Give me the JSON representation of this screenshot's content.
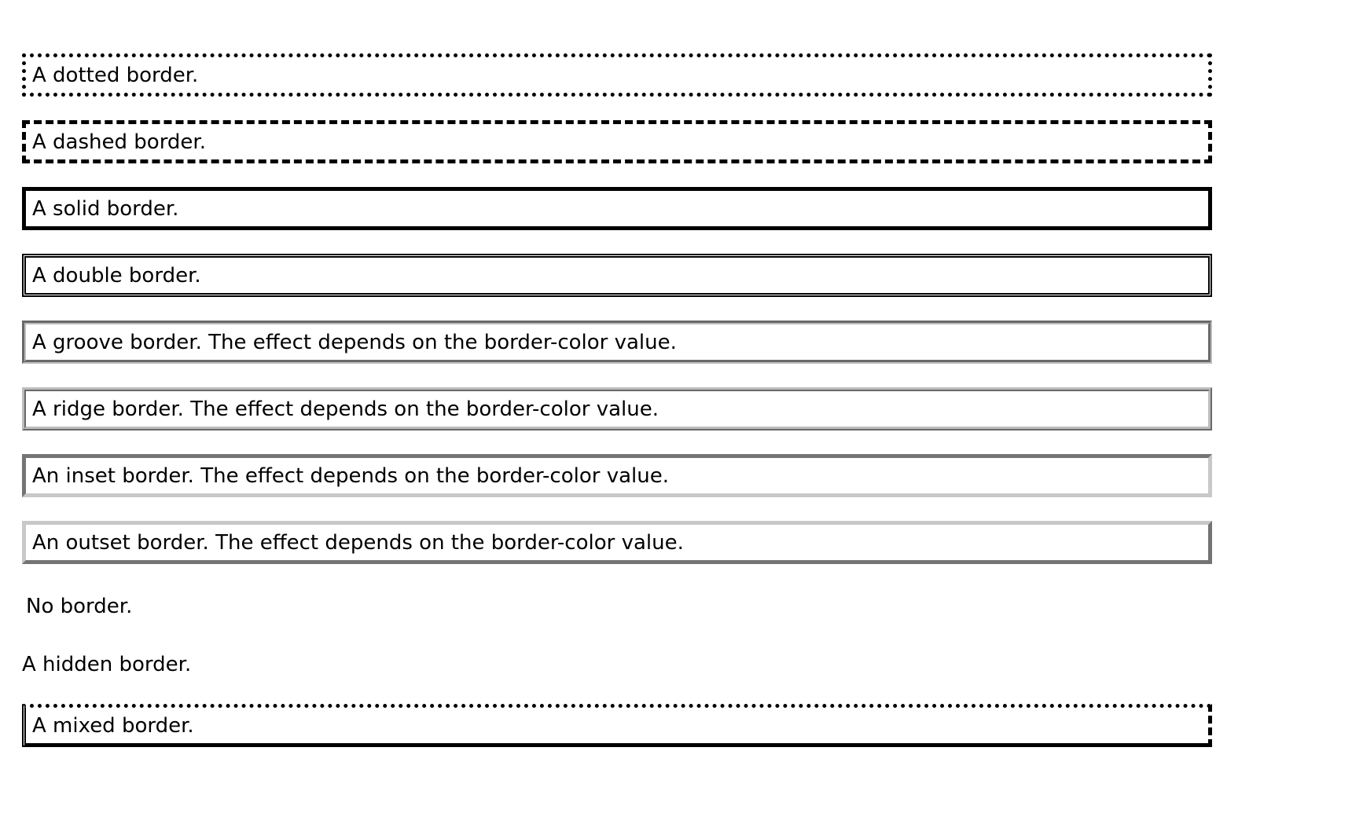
{
  "borders": {
    "dotted": "A dotted border.",
    "dashed": "A dashed border.",
    "solid": "A solid border.",
    "double": "A double border.",
    "groove": "A groove border. The effect depends on the border-color value.",
    "ridge": "A ridge border. The effect depends on the border-color value.",
    "inset": "An inset border. The effect depends on the border-color value.",
    "outset": "An outset border. The effect depends on the border-color value.",
    "none": "No border.",
    "hidden": "A hidden border.",
    "mixed": "A mixed border."
  },
  "colors": {
    "text": "#000000",
    "background": "#ffffff",
    "border_dark": "#000000",
    "border_gray": "#bdbdbd"
  }
}
